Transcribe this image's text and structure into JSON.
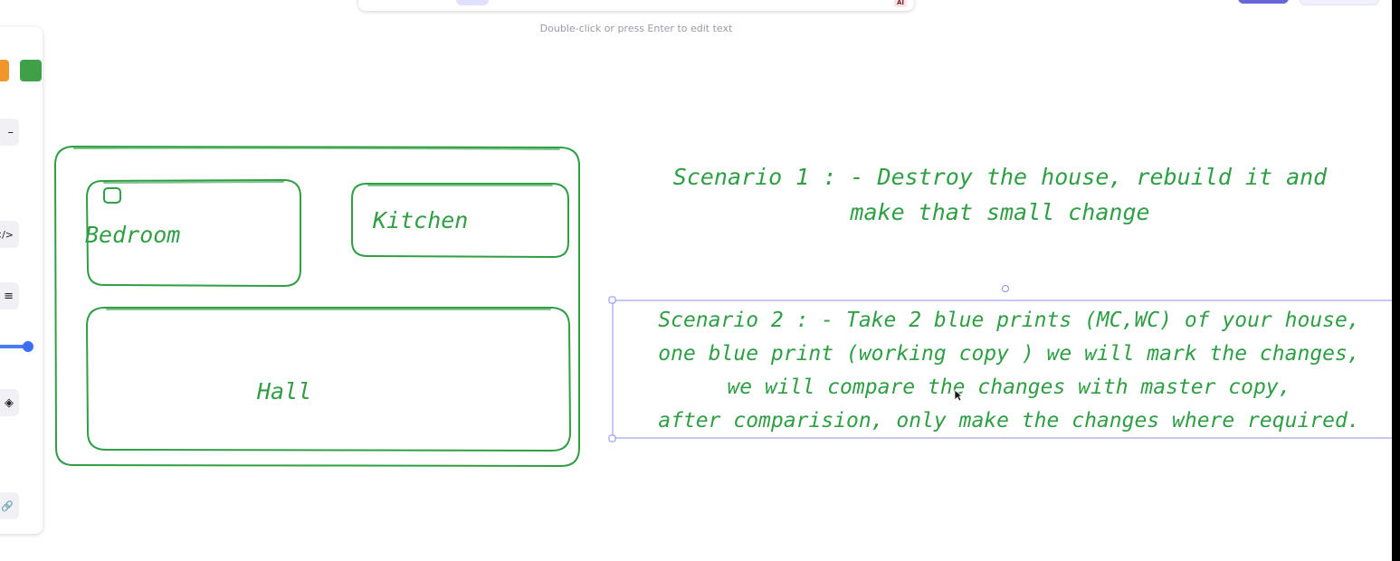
{
  "canvas": {
    "hint": "Double-click or press Enter to edit text",
    "toolbar_badge": "AI"
  },
  "colors": {
    "stroke": "#2f9e44",
    "selection": "#8a8ee8",
    "swatch_orange": "#f0962a",
    "swatch_green": "#40a04a",
    "accent": "#6965db"
  },
  "panel": {
    "buttons": [
      {
        "icon": "minus-icon",
        "glyph": "–"
      },
      {
        "icon": "code-icon",
        "glyph": "</>"
      },
      {
        "icon": "align-icon",
        "glyph": "≡"
      },
      {
        "icon": "layers-icon",
        "glyph": "◈"
      },
      {
        "icon": "link-icon",
        "glyph": "🔗"
      }
    ]
  },
  "house": {
    "rooms": {
      "bedroom": "Bedroom",
      "kitchen": "Kitchen",
      "hall": "Hall"
    }
  },
  "scenario1": {
    "lines": [
      "Scenario 1 : - Destroy the house, rebuild it and",
      "make that small change"
    ]
  },
  "scenario2": {
    "lines": [
      "Scenario 2 : - Take 2 blue prints (MC,WC) of your house,",
      "one blue print (working copy ) we will mark the changes,",
      "we will compare the changes with master copy,",
      "after comparision, only make the changes where required."
    ]
  }
}
